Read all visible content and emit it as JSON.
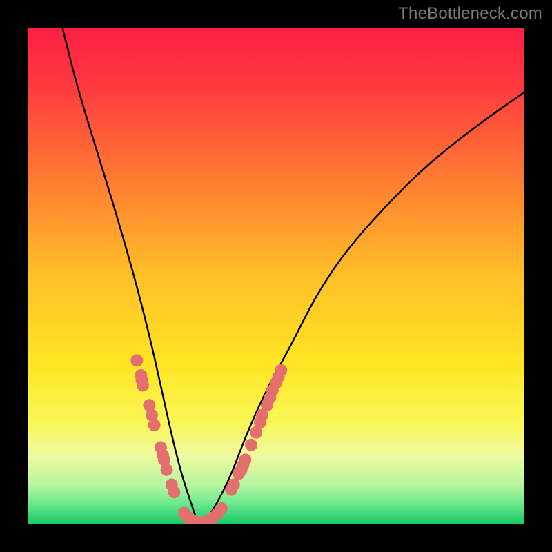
{
  "watermark": "TheBottleneck.com",
  "chart_data": {
    "type": "line",
    "title": "",
    "xlabel": "",
    "ylabel": "",
    "xlim": [
      0,
      100
    ],
    "ylim": [
      0,
      100
    ],
    "gradient_stops": [
      {
        "pos": 0.0,
        "color": "#ff1f44"
      },
      {
        "pos": 0.12,
        "color": "#ff3a3f"
      },
      {
        "pos": 0.3,
        "color": "#ff7a32"
      },
      {
        "pos": 0.5,
        "color": "#ffc028"
      },
      {
        "pos": 0.68,
        "color": "#ffe624"
      },
      {
        "pos": 0.8,
        "color": "#f8f85a"
      },
      {
        "pos": 0.86,
        "color": "#f0f9a0"
      },
      {
        "pos": 0.92,
        "color": "#b8f6a0"
      },
      {
        "pos": 0.96,
        "color": "#66e88c"
      },
      {
        "pos": 1.0,
        "color": "#18c663"
      }
    ],
    "series": [
      {
        "name": "bottleneck-curve",
        "x": [
          7,
          10,
          14,
          18,
          22,
          25,
          27,
          29,
          31,
          33,
          34,
          35,
          36,
          38,
          41,
          44,
          48,
          53,
          58,
          64,
          72,
          80,
          90,
          100
        ],
        "y": [
          100,
          88,
          75,
          62,
          48,
          36,
          27,
          18,
          10,
          4,
          1,
          0,
          1,
          4,
          10,
          18,
          27,
          36,
          46,
          55,
          64,
          72,
          80,
          87
        ]
      }
    ],
    "marker_clusters": [
      {
        "name": "left-cluster",
        "points": [
          {
            "x": 22.0,
            "y": 33.0
          },
          {
            "x": 22.8,
            "y": 30.0
          },
          {
            "x": 23.0,
            "y": 29.0
          },
          {
            "x": 23.2,
            "y": 28.0
          },
          {
            "x": 24.5,
            "y": 24.0
          },
          {
            "x": 25.0,
            "y": 22.0
          },
          {
            "x": 25.5,
            "y": 20.0
          },
          {
            "x": 26.8,
            "y": 15.5
          },
          {
            "x": 27.2,
            "y": 14.0
          },
          {
            "x": 27.5,
            "y": 13.0
          },
          {
            "x": 28.0,
            "y": 11.0
          },
          {
            "x": 29.0,
            "y": 8.0
          },
          {
            "x": 29.5,
            "y": 6.5
          }
        ]
      },
      {
        "name": "bottom-cluster",
        "points": [
          {
            "x": 31.5,
            "y": 2.3
          },
          {
            "x": 32.3,
            "y": 1.4
          },
          {
            "x": 33.2,
            "y": 0.8
          },
          {
            "x": 34.2,
            "y": 0.4
          },
          {
            "x": 35.2,
            "y": 0.4
          },
          {
            "x": 36.2,
            "y": 0.7
          },
          {
            "x": 37.2,
            "y": 1.3
          },
          {
            "x": 38.2,
            "y": 2.2
          },
          {
            "x": 39.0,
            "y": 3.2
          }
        ]
      },
      {
        "name": "right-cluster",
        "points": [
          {
            "x": 41.0,
            "y": 7.0
          },
          {
            "x": 41.5,
            "y": 8.0
          },
          {
            "x": 42.5,
            "y": 10.2
          },
          {
            "x": 43.0,
            "y": 11.0
          },
          {
            "x": 43.4,
            "y": 12.0
          },
          {
            "x": 43.8,
            "y": 13.0
          },
          {
            "x": 45.0,
            "y": 16.0
          },
          {
            "x": 46.0,
            "y": 18.5
          },
          {
            "x": 46.8,
            "y": 20.5
          },
          {
            "x": 47.2,
            "y": 22.0
          },
          {
            "x": 48.2,
            "y": 24.0
          },
          {
            "x": 48.8,
            "y": 25.5
          },
          {
            "x": 49.3,
            "y": 27.0
          },
          {
            "x": 50.0,
            "y": 28.5
          },
          {
            "x": 50.5,
            "y": 29.7
          },
          {
            "x": 51.0,
            "y": 31.0
          }
        ]
      }
    ],
    "curve_color": "#000000",
    "marker_color": "#e36f6f",
    "marker_radius_css_px": 9
  }
}
